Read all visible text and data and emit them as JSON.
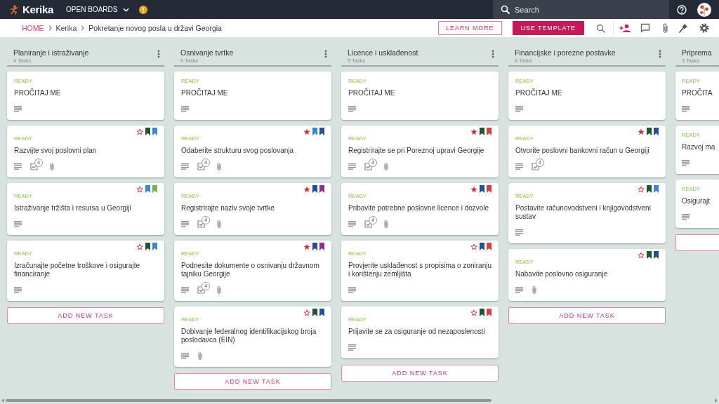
{
  "top_bar": {
    "app_name": "Kerika",
    "menu_label": "OPEN BOARDS",
    "search": {
      "placeholder": "Search"
    }
  },
  "breadcrumb": [
    {
      "label": "HOME",
      "kind": "home"
    },
    {
      "label": "Kerika",
      "kind": "link"
    },
    {
      "label": "Pokretanje novog posla u državi Georgia",
      "kind": "current"
    }
  ],
  "actions": [
    {
      "label": "LEARN MORE",
      "kind": "outlined"
    },
    {
      "label": "USE TEMPLATE",
      "kind": "filled"
    }
  ],
  "columns": [
    {
      "title": "Planiranje i istraživanje",
      "count": "4 Tasks",
      "cut_off": false,
      "cards": [
        {
          "status": "READY",
          "title": "PROČITAJ ME",
          "badges": [
            {
              "kind": "description"
            }
          ]
        },
        {
          "status": "READY",
          "title": "Razvijte svoj poslovni plan",
          "marker_row": {
            "starred": false,
            "tags": [
              {
                "color": "#1e5631"
              },
              {
                "color": "#2f8be0"
              }
            ]
          },
          "badges": [
            {
              "kind": "description"
            },
            {
              "kind": "checklist",
              "count": "4"
            },
            {
              "kind": "attachment"
            }
          ]
        },
        {
          "status": "READY",
          "title": "Istraživanje tržišta i resursa u Georgiji",
          "marker_row": {
            "starred": false,
            "tags": [
              {
                "color": "#2f8be0"
              },
              {
                "color": "#7cb342"
              }
            ]
          },
          "badges": [
            {
              "kind": "description"
            }
          ]
        },
        {
          "status": "READY",
          "title": "Izračunajte početne troškove i osigurajte financiranje",
          "marker_row": {
            "starred": false,
            "tags": [
              {
                "color": "#1e5631"
              },
              {
                "color": "#2f8be0"
              }
            ]
          },
          "badges": [
            {
              "kind": "description"
            }
          ]
        }
      ],
      "add_task_button": {
        "shown": true,
        "label": "ADD NEW TASK"
      }
    },
    {
      "title": "Osnivanje tvrtke",
      "count": "5 Tasks",
      "cut_off": false,
      "cards": [
        {
          "status": "READY",
          "title": "PROČITAJ ME",
          "badges": [
            {
              "kind": "description"
            }
          ]
        },
        {
          "status": "READY",
          "title": "Odaberite strukturu svog poslovanja",
          "marker_row": {
            "starred": true,
            "tags": [
              {
                "color": "#2f8be0"
              },
              {
                "color": "#1f4fa3"
              }
            ]
          },
          "badges": [
            {
              "kind": "description"
            },
            {
              "kind": "checklist",
              "count": "4"
            },
            {
              "kind": "attachment"
            }
          ]
        },
        {
          "status": "READY",
          "title": "Registrirajte naziv svoje tvrtke",
          "marker_row": {
            "starred": true,
            "tags": [
              {
                "color": "#1f4fa3"
              },
              {
                "color": "#9b2a8f"
              }
            ]
          },
          "badges": [
            {
              "kind": "description"
            },
            {
              "kind": "checklist",
              "count": "4"
            },
            {
              "kind": "attachment"
            }
          ]
        },
        {
          "status": "READY",
          "title": "Podnesite dokumente o osnivanju državnom tajniku Georgije",
          "marker_row": {
            "starred": true,
            "tags": [
              {
                "color": "#1f4fa3"
              },
              {
                "color": "#9b2a8f"
              }
            ]
          },
          "badges": [
            {
              "kind": "description"
            },
            {
              "kind": "checklist",
              "count": "4"
            },
            {
              "kind": "attachment"
            }
          ]
        },
        {
          "status": "READY",
          "title": "Dobivanje federalnog identifikacijskog broja poslodavca (EIN)",
          "marker_row": {
            "starred": false,
            "tags": [
              {
                "color": "#1e5631"
              },
              {
                "color": "#1f4fa3"
              }
            ]
          },
          "badges": [
            {
              "kind": "description"
            },
            {
              "kind": "attachment"
            }
          ]
        }
      ],
      "add_task_button": {
        "shown": true,
        "label": "ADD NEW TASK"
      }
    },
    {
      "title": "Licence i usklađenost",
      "count": "5 Tasks",
      "cut_off": false,
      "cards": [
        {
          "status": "READY",
          "title": "PROČITAJ ME",
          "badges": [
            {
              "kind": "description"
            }
          ]
        },
        {
          "status": "READY",
          "title": "Registrirajte se pri Poreznoj upravi Georgije",
          "marker_row": {
            "starred": true,
            "tags": [
              {
                "color": "#1e5631"
              },
              {
                "color": "#e53935"
              }
            ]
          },
          "badges": [
            {
              "kind": "description"
            },
            {
              "kind": "checklist",
              "count": "4"
            },
            {
              "kind": "attachment"
            }
          ]
        },
        {
          "status": "READY",
          "title": "Pribavite potrebne poslovne licence i dozvole",
          "marker_row": {
            "starred": true,
            "tags": [
              {
                "color": "#1f4fa3"
              },
              {
                "color": "#e53935"
              }
            ]
          },
          "badges": [
            {
              "kind": "description"
            },
            {
              "kind": "checklist",
              "count": "4"
            },
            {
              "kind": "attachment"
            }
          ]
        },
        {
          "status": "READY",
          "title": "Provjerite usklađenost s propisima o zoniranju i korištenju zemljišta",
          "marker_row": {
            "starred": false,
            "tags": [
              {
                "color": "#1f4fa3"
              },
              {
                "color": "#e53935"
              }
            ]
          },
          "badges": [
            {
              "kind": "description"
            }
          ]
        },
        {
          "status": "READY",
          "title": "Prijavite se za osiguranje od nezaposlenosti",
          "marker_row": {
            "starred": false,
            "tags": [
              {
                "color": "#1e5631"
              },
              {
                "color": "#e53935"
              }
            ]
          },
          "badges": [
            {
              "kind": "description"
            }
          ]
        }
      ],
      "add_task_button": {
        "shown": true,
        "label": "ADD NEW TASK"
      }
    },
    {
      "title": "Financijske i porezne postavke",
      "count": "4 Tasks",
      "cut_off": false,
      "cards": [
        {
          "status": "READY",
          "title": "PROČITAJ ME",
          "badges": [
            {
              "kind": "description"
            }
          ]
        },
        {
          "status": "READY",
          "title": "Otvorite poslovni bankovni račun u Georgiji",
          "marker_row": {
            "starred": true,
            "tags": [
              {
                "color": "#1e5631"
              },
              {
                "color": "#1f4fa3"
              }
            ]
          },
          "badges": [
            {
              "kind": "description"
            },
            {
              "kind": "checklist",
              "count": "4"
            }
          ]
        },
        {
          "status": "READY",
          "title": "Postavite računovodstveni i knjigovodstveni sustav",
          "marker_row": {
            "starred": false,
            "tags": [
              {
                "color": "#1e5631"
              },
              {
                "color": "#2f8be0"
              }
            ]
          },
          "badges": [
            {
              "kind": "description"
            }
          ]
        },
        {
          "status": "READY",
          "title": "Nabavite poslovno osiguranje",
          "marker_row": {
            "starred": false,
            "tags": [
              {
                "color": "#1e5631"
              },
              {
                "color": "#1f4fa3"
              }
            ]
          },
          "badges": [
            {
              "kind": "description"
            },
            {
              "kind": "attachment"
            }
          ]
        }
      ],
      "add_task_button": {
        "shown": true,
        "label": "ADD NEW TASK"
      }
    },
    {
      "title": "Priprema",
      "count": "3 Tasks",
      "cut_off": true,
      "cards": [
        {
          "status": "READY",
          "title": "PROČITA",
          "badges": [
            {
              "kind": "description"
            }
          ]
        },
        {
          "status": "READY",
          "title": "Razvoj ma",
          "badges": [
            {
              "kind": "description"
            }
          ]
        },
        {
          "status": "READY",
          "title": "Osigurajt",
          "badges": [
            {
              "kind": "description"
            }
          ]
        }
      ],
      "add_task_button": {
        "shown": true
      }
    }
  ]
}
